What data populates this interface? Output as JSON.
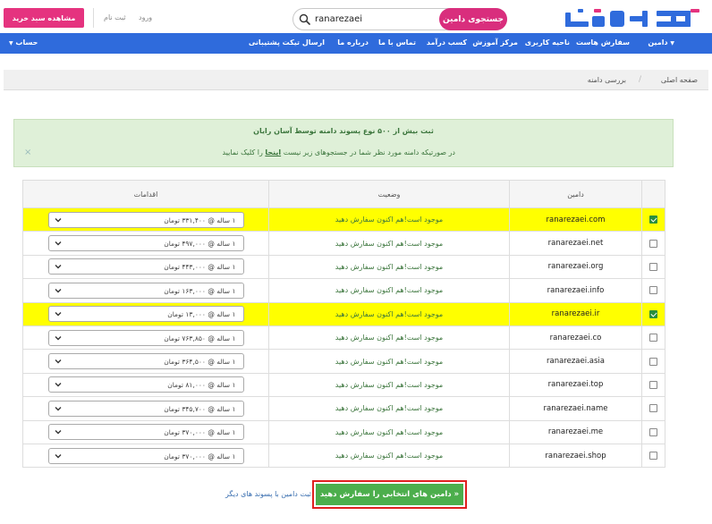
{
  "header": {
    "logo_text": "آسان رایان",
    "search_value": "ranarezaei",
    "search_button": "جستجوی دامین",
    "login": "ورود",
    "register": "ثبت نام",
    "cart_button": "مشاهده سبد خرید"
  },
  "nav": {
    "domain": "دامین",
    "hosting": "سفارش هاست",
    "user_area": "ناحیه کاربری",
    "training": "مرکز آموزش",
    "earn": "کسب درآمد",
    "contact": "تماس با ما",
    "about": "درباره ما",
    "ticket": "ارسال تیکت پشتیبانی",
    "account": "حساب"
  },
  "breadcrumb": {
    "home": "صفحه اصلی",
    "separator": "/",
    "current": "بررسی دامنه"
  },
  "alert": {
    "title": "ثبت بیش از ۵۰۰ نوع پسوند دامنه توسط آسان رایان",
    "body": "در صورتیکه دامنه مورد نظر شما در جستجوهای زیر نیست",
    "link": "اینجا",
    "body_end": "را کلیک نمایید",
    "close": "×"
  },
  "table": {
    "headers": {
      "domain": "دامین",
      "status": "وضعیت",
      "actions": "اقدامات"
    },
    "rows": [
      {
        "domain": "ranarezaei.com",
        "status": "موجود است!هم اکنون سفارش دهید",
        "price": "۱ ساله @ ۳۳۱,۴۰۰ تومان",
        "selected": true
      },
      {
        "domain": "ranarezaei.net",
        "status": "موجود است!هم اکنون سفارش دهید",
        "price": "۱ ساله @ ۴۹۷,۰۰۰ تومان",
        "selected": false
      },
      {
        "domain": "ranarezaei.org",
        "status": "موجود است!هم اکنون سفارش دهید",
        "price": "۱ ساله @ ۴۴۳,۰۰۰ تومان",
        "selected": false
      },
      {
        "domain": "ranarezaei.info",
        "status": "موجود است!هم اکنون سفارش دهید",
        "price": "۱ ساله @ ۱۶۳,۰۰۰ تومان",
        "selected": false
      },
      {
        "domain": "ranarezaei.ir",
        "status": "موجود است!هم اکنون سفارش دهید",
        "price": "۱ ساله @ ۱۳,۰۰۰ تومان",
        "selected": true
      },
      {
        "domain": "ranarezaei.co",
        "status": "موجود است!هم اکنون سفارش دهید",
        "price": "۱ ساله @ ۷۶۳,۸۵۰ تومان",
        "selected": false
      },
      {
        "domain": "ranarezaei.asia",
        "status": "موجود است!هم اکنون سفارش دهید",
        "price": "۱ ساله @ ۳۶۴,۵۰۰ تومان",
        "selected": false
      },
      {
        "domain": "ranarezaei.top",
        "status": "موجود است!هم اکنون سفارش دهید",
        "price": "۱ ساله @ ۸۱,۰۰۰ تومان",
        "selected": false
      },
      {
        "domain": "ranarezaei.name",
        "status": "موجود است!هم اکنون سفارش دهید",
        "price": "۱ ساله @ ۳۴۵,۷۰۰ تومان",
        "selected": false
      },
      {
        "domain": "ranarezaei.me",
        "status": "موجود است!هم اکنون سفارش دهید",
        "price": "۱ ساله @ ۳۷۰,۰۰۰ تومان",
        "selected": false
      },
      {
        "domain": "ranarezaei.shop",
        "status": "موجود است!هم اکنون سفارش دهید",
        "price": "۱ ساله @ ۳۷۰,۰۰۰ تومان",
        "selected": false
      }
    ]
  },
  "footer": {
    "order_button": "دامین های انتخابی را سفارش دهید »",
    "other_link": "ثبت دامین با پسوند های دیگر"
  },
  "colors": {
    "nav_bg": "#2f6bdc",
    "search_button": "#d92e7d",
    "cart_button": "#e5337f",
    "selected_row": "#ffff00",
    "order_button": "#4cae4c",
    "alert_bg": "#dff0d8"
  }
}
